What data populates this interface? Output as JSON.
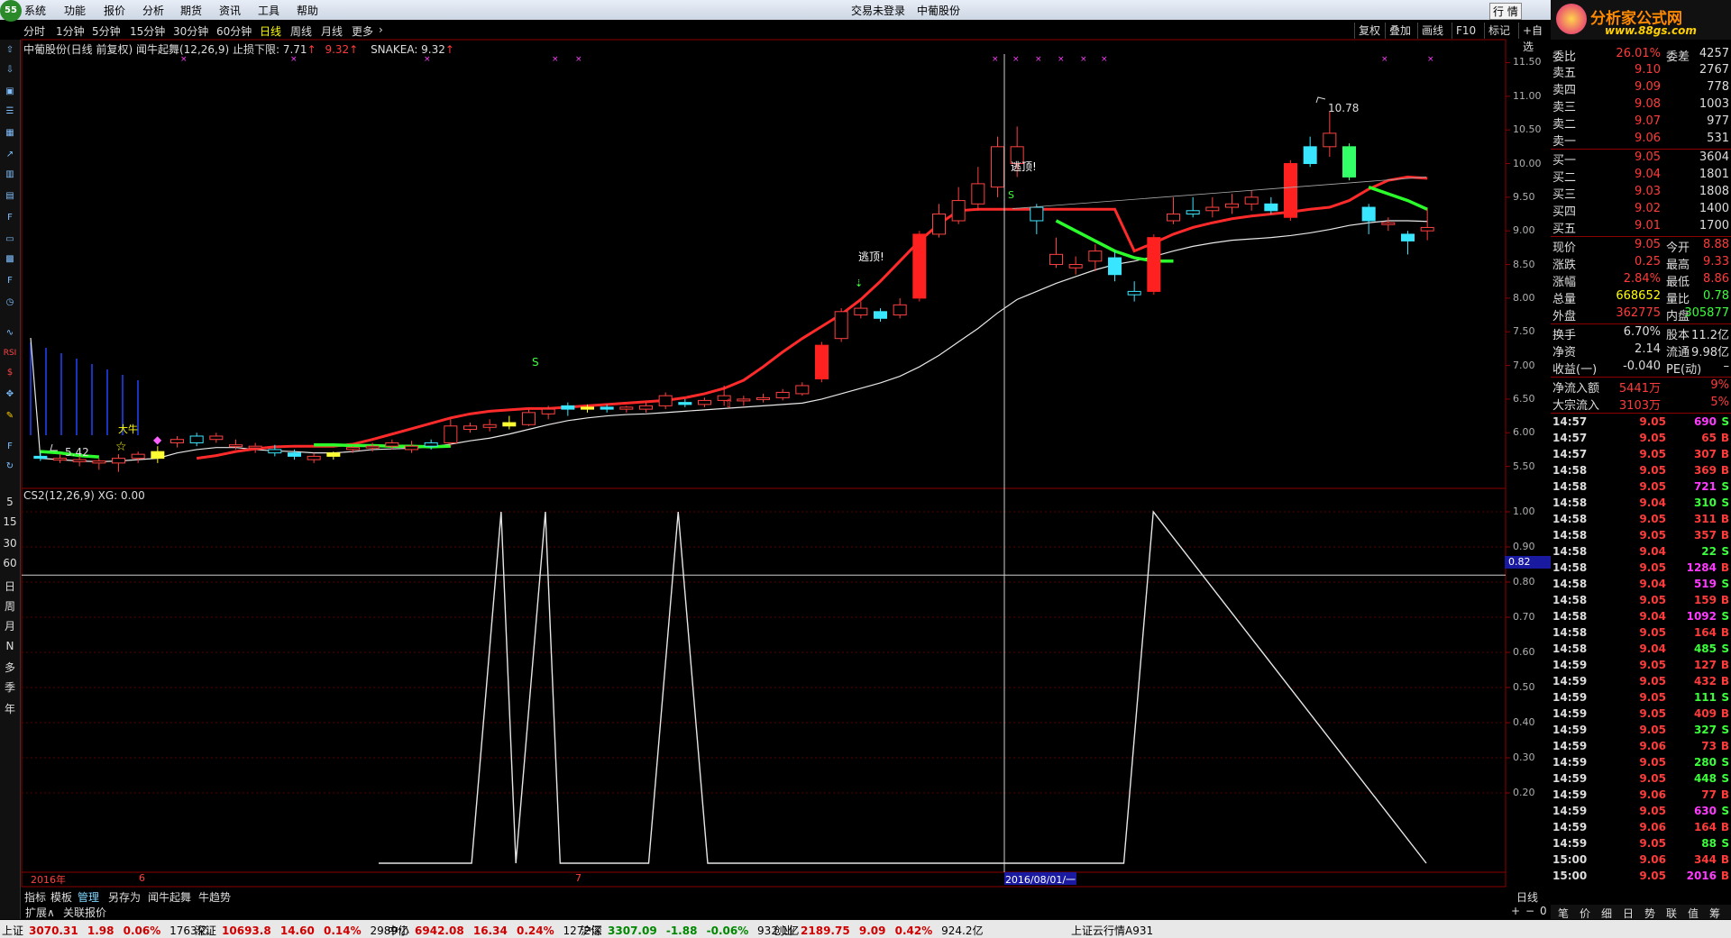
{
  "menu": [
    "系统",
    "功能",
    "报价",
    "分析",
    "期货",
    "资讯",
    "工具",
    "帮助"
  ],
  "menu_center": [
    "交易未登录",
    "中葡股份"
  ],
  "window_buttons": [
    "行",
    "情"
  ],
  "brand": {
    "name": "分析家公式网",
    "url": "www.88gs.com",
    "badge": "55"
  },
  "periods": [
    "分时",
    "1分钟",
    "5分钟",
    "15分钟",
    "30分钟",
    "60分钟",
    "日线",
    "周线",
    "月线",
    "更多"
  ],
  "active_period": "日线",
  "right_buttons": [
    "复权",
    "叠加",
    "画线",
    "F10",
    "标记",
    "+自选"
  ],
  "left_tools": [
    "RSI"
  ],
  "left_periods": [
    "5",
    "15",
    "30",
    "60",
    "日",
    "周",
    "月",
    "N",
    "多",
    "季",
    "年"
  ],
  "main_title": {
    "prefix": "中葡股份(日线 前复权) 闻牛起舞(12,26,9) 止损下限: 7.71",
    "v2": "9.32",
    "snake": "SNAKEA: 9.32"
  },
  "sub_title": "CS2(12,26,9) XG: 0.00",
  "main_axis": [
    "11.50",
    "11.00",
    "10.50",
    "10.00",
    "9.50",
    "9.00",
    "8.50",
    "8.00",
    "7.50",
    "7.00",
    "6.50",
    "6.00",
    "5.50"
  ],
  "sub_axis": [
    "1.00",
    "0.90",
    "0.80",
    "0.70",
    "0.60",
    "0.50",
    "0.40",
    "0.30",
    "0.20"
  ],
  "crosshair_value": "0.82",
  "crosshair_date": "2016/08/01/一",
  "x_labels": [
    "2016年",
    "6",
    "7"
  ],
  "annotations": {
    "high": "10.78",
    "low": "5.42",
    "escape1": "逃顶!",
    "escape2": "逃顶!",
    "s": "S",
    "dn": "大牛"
  },
  "bottom_tabs": [
    "指标",
    "模板",
    "管理",
    "另存为",
    "闻牛起舞",
    "牛趋势"
  ],
  "bottom_tabs2": [
    "扩展∧",
    "关联报价"
  ],
  "day_label": "日线",
  "orderbook": {
    "ratio": {
      "label": "委比",
      "value": "26.01%",
      "label2": "委差",
      "value2": "4257"
    },
    "sells": [
      {
        "l": "卖五",
        "p": "9.10",
        "v": "2767"
      },
      {
        "l": "卖四",
        "p": "9.09",
        "v": "778"
      },
      {
        "l": "卖三",
        "p": "9.08",
        "v": "1003"
      },
      {
        "l": "卖二",
        "p": "9.07",
        "v": "977"
      },
      {
        "l": "卖一",
        "p": "9.06",
        "v": "531"
      }
    ],
    "buys": [
      {
        "l": "买一",
        "p": "9.05",
        "v": "3604"
      },
      {
        "l": "买二",
        "p": "9.04",
        "v": "1801"
      },
      {
        "l": "买三",
        "p": "9.03",
        "v": "1808"
      },
      {
        "l": "买四",
        "p": "9.02",
        "v": "1400"
      },
      {
        "l": "买五",
        "p": "9.01",
        "v": "1700"
      }
    ]
  },
  "quote": [
    {
      "l": "现价",
      "v": "9.05",
      "l2": "今开",
      "v2": "8.88"
    },
    {
      "l": "涨跌",
      "v": "0.25",
      "l2": "最高",
      "v2": "9.33"
    },
    {
      "l": "涨幅",
      "v": "2.84%",
      "l2": "最低",
      "v2": "8.86"
    },
    {
      "l": "总量",
      "v": "668652",
      "l2": "量比",
      "v2": "0.78"
    },
    {
      "l": "外盘",
      "v": "362775",
      "l2": "内盘",
      "v2": "305877"
    },
    {
      "l": "换手",
      "v": "6.70%",
      "l2": "股本",
      "v2": "11.2亿"
    },
    {
      "l": "净资",
      "v": "2.14",
      "l2": "流通",
      "v2": "9.98亿"
    },
    {
      "l": "收益(一)",
      "v": "-0.040",
      "l2": "PE(动)",
      "v2": "–"
    },
    {
      "l": "净流入额",
      "v": "5441万",
      "l2": "",
      "v2": "9%"
    },
    {
      "l": "大宗流入",
      "v": "3103万",
      "l2": "",
      "v2": "5%"
    }
  ],
  "ticks": [
    [
      "14:57",
      "9.05",
      "690",
      "S"
    ],
    [
      "14:57",
      "9.05",
      "65",
      "B"
    ],
    [
      "14:57",
      "9.05",
      "307",
      "B"
    ],
    [
      "14:58",
      "9.05",
      "369",
      "B"
    ],
    [
      "14:58",
      "9.05",
      "721",
      "S"
    ],
    [
      "14:58",
      "9.04",
      "310",
      "S"
    ],
    [
      "14:58",
      "9.05",
      "311",
      "B"
    ],
    [
      "14:58",
      "9.05",
      "357",
      "B"
    ],
    [
      "14:58",
      "9.04",
      "22",
      "S"
    ],
    [
      "14:58",
      "9.05",
      "1284",
      "B"
    ],
    [
      "14:58",
      "9.04",
      "519",
      "S"
    ],
    [
      "14:58",
      "9.05",
      "159",
      "B"
    ],
    [
      "14:58",
      "9.04",
      "1092",
      "S"
    ],
    [
      "14:58",
      "9.05",
      "164",
      "B"
    ],
    [
      "14:58",
      "9.04",
      "485",
      "S"
    ],
    [
      "14:59",
      "9.05",
      "127",
      "B"
    ],
    [
      "14:59",
      "9.05",
      "432",
      "B"
    ],
    [
      "14:59",
      "9.05",
      "111",
      "S"
    ],
    [
      "14:59",
      "9.05",
      "409",
      "B"
    ],
    [
      "14:59",
      "9.05",
      "327",
      "S"
    ],
    [
      "14:59",
      "9.06",
      "73",
      "B"
    ],
    [
      "14:59",
      "9.05",
      "280",
      "S"
    ],
    [
      "14:59",
      "9.05",
      "448",
      "S"
    ],
    [
      "14:59",
      "9.06",
      "77",
      "B"
    ],
    [
      "14:59",
      "9.05",
      "630",
      "S"
    ],
    [
      "14:59",
      "9.06",
      "164",
      "B"
    ],
    [
      "14:59",
      "9.05",
      "88",
      "S"
    ],
    [
      "15:00",
      "9.06",
      "344",
      "B"
    ],
    [
      "15:00",
      "9.05",
      "2016",
      "B"
    ]
  ],
  "right_tabs": [
    "笔",
    "价",
    "细",
    "日",
    "势",
    "联",
    "值",
    "筹"
  ],
  "status": [
    {
      "t": "上证",
      "v": "3070.31",
      "c": "1.98",
      "p": "0.06%",
      "a": "1763亿"
    },
    {
      "t": "深证",
      "v": "10693.8",
      "c": "14.60",
      "p": "0.14%",
      "a": "2989亿"
    },
    {
      "t": "中小",
      "v": "6942.08",
      "c": "16.34",
      "p": "0.24%",
      "a": "1272亿"
    },
    {
      "t": "沪深",
      "v": "3307.09",
      "c": "-1.88",
      "p": "-0.06%",
      "a": "932.1亿"
    },
    {
      "t": "创业",
      "v": "2189.75",
      "c": "9.09",
      "p": "0.42%",
      "a": "924.2亿"
    }
  ],
  "status_right": "上证云行情A931",
  "chart_data": {
    "type": "line",
    "title": "",
    "main": {
      "ylim": [
        5.2,
        11.6
      ],
      "candles": [
        [
          5.62,
          5.65,
          5.58,
          5.7,
          "c"
        ],
        [
          5.6,
          5.62,
          5.55,
          5.68,
          "w"
        ],
        [
          5.57,
          5.6,
          5.5,
          5.65,
          "w"
        ],
        [
          5.55,
          5.58,
          5.45,
          5.62,
          "w"
        ],
        [
          5.55,
          5.62,
          5.42,
          5.68,
          "w"
        ],
        [
          5.62,
          5.68,
          5.55,
          5.72,
          "w"
        ],
        [
          5.62,
          5.72,
          5.55,
          5.8,
          "y"
        ],
        [
          5.85,
          5.9,
          5.78,
          5.95,
          "w"
        ],
        [
          5.95,
          5.85,
          5.8,
          6.0,
          "w"
        ],
        [
          5.9,
          5.95,
          5.85,
          6.0,
          "w"
        ],
        [
          5.8,
          5.82,
          5.75,
          5.9,
          "w"
        ],
        [
          5.78,
          5.8,
          5.7,
          5.85,
          "w"
        ],
        [
          5.75,
          5.7,
          5.65,
          5.82,
          "w"
        ],
        [
          5.65,
          5.7,
          5.6,
          5.75,
          "c"
        ],
        [
          5.6,
          5.65,
          5.55,
          5.7,
          "w"
        ],
        [
          5.65,
          5.7,
          5.6,
          5.72,
          "y"
        ],
        [
          5.75,
          5.78,
          5.7,
          5.8,
          "w"
        ],
        [
          5.78,
          5.8,
          5.72,
          5.85,
          "w"
        ],
        [
          5.8,
          5.85,
          5.75,
          5.9,
          "w"
        ],
        [
          5.75,
          5.8,
          5.7,
          5.88,
          "w"
        ],
        [
          5.85,
          5.8,
          5.75,
          5.9,
          "w"
        ],
        [
          5.85,
          6.1,
          5.8,
          6.2,
          "w"
        ],
        [
          6.05,
          6.1,
          6.0,
          6.15,
          "w"
        ],
        [
          6.08,
          6.12,
          6.02,
          6.2,
          "w"
        ],
        [
          6.1,
          6.15,
          6.05,
          6.25,
          "y"
        ],
        [
          6.12,
          6.3,
          6.1,
          6.35,
          "w"
        ],
        [
          6.28,
          6.35,
          6.2,
          6.4,
          "w"
        ],
        [
          6.35,
          6.4,
          6.25,
          6.45,
          "c"
        ],
        [
          6.35,
          6.38,
          6.3,
          6.42,
          "y"
        ],
        [
          6.38,
          6.35,
          6.3,
          6.42,
          "c"
        ],
        [
          6.35,
          6.38,
          6.3,
          6.4,
          "w"
        ],
        [
          6.35,
          6.4,
          6.3,
          6.45,
          "w"
        ],
        [
          6.4,
          6.55,
          6.35,
          6.6,
          "w"
        ],
        [
          6.45,
          6.42,
          6.38,
          6.5,
          "c"
        ],
        [
          6.42,
          6.48,
          6.38,
          6.52,
          "w"
        ],
        [
          6.48,
          6.55,
          6.4,
          6.7,
          "w"
        ],
        [
          6.48,
          6.5,
          6.4,
          6.55,
          "w"
        ],
        [
          6.5,
          6.52,
          6.45,
          6.58,
          "w"
        ],
        [
          6.52,
          6.6,
          6.48,
          6.65,
          "w"
        ],
        [
          6.58,
          6.7,
          6.55,
          6.75,
          "w"
        ],
        [
          6.8,
          7.3,
          6.75,
          7.35,
          "r"
        ],
        [
          7.4,
          7.8,
          7.35,
          7.85,
          "w"
        ],
        [
          7.75,
          7.85,
          7.7,
          7.95,
          "w"
        ],
        [
          7.8,
          7.7,
          7.65,
          7.85,
          "c"
        ],
        [
          7.75,
          7.9,
          7.7,
          8.0,
          "w"
        ],
        [
          8.0,
          8.95,
          7.95,
          9.0,
          "r"
        ],
        [
          8.95,
          9.25,
          8.9,
          9.4,
          "w"
        ],
        [
          9.15,
          9.45,
          9.1,
          9.65,
          "w"
        ],
        [
          9.4,
          9.7,
          9.3,
          9.95,
          "w"
        ],
        [
          9.65,
          10.25,
          9.5,
          10.4,
          "w"
        ],
        [
          10.0,
          10.25,
          9.8,
          10.55,
          "w"
        ],
        [
          9.35,
          9.15,
          8.95,
          9.4,
          "w"
        ],
        [
          8.5,
          8.65,
          8.45,
          8.9,
          "w"
        ],
        [
          8.45,
          8.5,
          8.35,
          8.62,
          "w"
        ],
        [
          8.55,
          8.7,
          8.4,
          8.8,
          "w"
        ],
        [
          8.6,
          8.35,
          8.25,
          8.7,
          "c"
        ],
        [
          8.1,
          8.05,
          7.95,
          8.25,
          "w"
        ],
        [
          8.1,
          8.9,
          8.05,
          8.95,
          "r"
        ],
        [
          9.15,
          9.25,
          9.1,
          9.5,
          "w"
        ],
        [
          9.3,
          9.25,
          9.2,
          9.5,
          "w"
        ],
        [
          9.3,
          9.35,
          9.2,
          9.5,
          "w"
        ],
        [
          9.35,
          9.4,
          9.25,
          9.55,
          "w"
        ],
        [
          9.4,
          9.5,
          9.3,
          9.6,
          "w"
        ],
        [
          9.4,
          9.3,
          9.25,
          9.5,
          "c"
        ],
        [
          9.2,
          10.0,
          9.15,
          10.05,
          "r"
        ],
        [
          10.0,
          10.25,
          9.95,
          10.4,
          "c"
        ],
        [
          10.25,
          10.45,
          10.1,
          10.78,
          "w"
        ],
        [
          10.25,
          9.8,
          9.75,
          10.3,
          "g"
        ],
        [
          9.35,
          9.15,
          8.95,
          9.4,
          "c"
        ],
        [
          9.1,
          9.12,
          9.0,
          9.2,
          "w"
        ],
        [
          8.85,
          8.95,
          8.65,
          9.0,
          "c"
        ],
        [
          9.0,
          9.05,
          8.86,
          9.33,
          "w"
        ]
      ],
      "ma_white": [
        5.62,
        5.6,
        5.58,
        5.57,
        5.58,
        5.6,
        5.62,
        5.7,
        5.75,
        5.78,
        5.78,
        5.75,
        5.73,
        5.72,
        5.7,
        5.7,
        5.72,
        5.75,
        5.76,
        5.77,
        5.79,
        5.83,
        5.88,
        5.92,
        5.98,
        6.05,
        6.12,
        6.18,
        6.22,
        6.25,
        6.27,
        6.28,
        6.3,
        6.32,
        6.34,
        6.36,
        6.38,
        6.4,
        6.42,
        6.44,
        6.5,
        6.58,
        6.66,
        6.74,
        6.84,
        6.98,
        7.15,
        7.35,
        7.55,
        7.78,
        7.98,
        8.1,
        8.22,
        8.32,
        8.42,
        8.5,
        8.55,
        8.62,
        8.7,
        8.77,
        8.82,
        8.86,
        8.88,
        8.9,
        8.93,
        8.97,
        9.02,
        9.08,
        9.12,
        9.15,
        9.15,
        9.14
      ],
      "ma_red_from": 8,
      "ma_red": [
        5.62,
        5.66,
        5.72,
        5.76,
        5.79,
        5.8,
        5.8,
        5.8,
        5.83,
        5.9,
        5.98,
        6.06,
        6.14,
        6.22,
        6.28,
        6.32,
        6.34,
        6.36,
        6.36,
        6.38,
        6.4,
        6.42,
        6.44,
        6.46,
        6.48,
        6.52,
        6.58,
        6.66,
        6.78,
        6.98,
        7.2,
        7.4,
        7.58,
        7.76,
        7.98,
        8.25,
        8.55,
        8.85,
        9.1,
        9.3,
        9.32,
        9.32,
        9.32,
        9.32,
        9.32,
        9.32,
        9.32,
        9.32,
        8.7,
        8.82,
        8.95,
        9.05,
        9.12,
        9.18,
        9.22,
        9.25,
        9.28,
        9.32,
        9.35,
        9.45,
        9.62,
        9.75,
        9.8,
        9.78
      ],
      "ma_green_segments": [
        [
          0,
          3,
          [
            5.72,
            5.7,
            5.66,
            5.64
          ]
        ],
        [
          14,
          21,
          [
            5.82,
            5.82,
            5.81,
            5.81,
            5.8,
            5.8,
            5.79,
            5.8
          ]
        ],
        [
          52,
          58,
          [
            9.15,
            9.0,
            8.85,
            8.7,
            8.6,
            8.55,
            8.55
          ]
        ],
        [
          68,
          71,
          [
            9.65,
            9.55,
            9.45,
            9.32
          ]
        ]
      ]
    },
    "sub": {
      "ylim": [
        0,
        1
      ],
      "x": [
        0,
        6.3,
        8.3,
        9.3,
        11.3,
        12.3,
        14.3,
        18.3,
        20.3,
        22.3,
        48.5,
        50.5,
        52.5,
        71
      ],
      "y": [
        0,
        0,
        1,
        0,
        1,
        0,
        0,
        0,
        1,
        0,
        0,
        0,
        1,
        0
      ]
    }
  }
}
